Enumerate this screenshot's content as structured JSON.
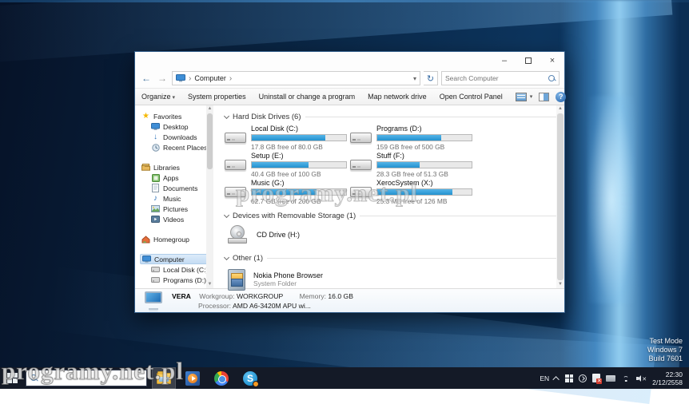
{
  "desktop": {
    "watermark_text": "programy.net.pl",
    "test_mode": {
      "l1": "Test Mode",
      "l2": "Windows 7",
      "l3": "Build 7601"
    }
  },
  "icons": {
    "back": "←",
    "forward": "→",
    "refresh": "↻",
    "caret": "▾",
    "breadcrumb_sep": "›",
    "minimize": "–",
    "close": "×",
    "help": "?",
    "star": "★",
    "music_note": "♪",
    "download_arrow": "↓",
    "scroll_up": "▲",
    "scroll_down": "▼",
    "skype_s": "S",
    "volume_mute": "✕"
  },
  "window": {
    "address": {
      "path": "Computer",
      "search_placeholder": "Search Computer"
    },
    "toolbar": {
      "organize": "Organize",
      "system_properties": "System properties",
      "uninstall": "Uninstall or change a program",
      "map_drive": "Map network drive",
      "control_panel": "Open Control Panel"
    },
    "sidebar": {
      "favorites": {
        "label": "Favorites",
        "items": [
          {
            "label": "Desktop"
          },
          {
            "label": "Downloads"
          },
          {
            "label": "Recent Places"
          }
        ]
      },
      "libraries": {
        "label": "Libraries",
        "items": [
          {
            "label": "Apps"
          },
          {
            "label": "Documents"
          },
          {
            "label": "Music"
          },
          {
            "label": "Pictures"
          },
          {
            "label": "Videos"
          }
        ]
      },
      "homegroup": {
        "label": "Homegroup"
      },
      "computer": {
        "label": "Computer",
        "items": [
          {
            "label": "Local Disk (C:)"
          },
          {
            "label": "Programs (D:)"
          }
        ]
      }
    },
    "groups": {
      "hdd_title": "Hard Disk Drives (6)",
      "removable_title": "Devices with Removable Storage (1)",
      "other_title": "Other (1)"
    },
    "drives": [
      {
        "name": "Local Disk (C:)",
        "free": "17.8 GB free of 80.0 GB",
        "used_percent": 78
      },
      {
        "name": "Programs (D:)",
        "free": "159 GB free of 500 GB",
        "used_percent": 68
      },
      {
        "name": "Setup (E:)",
        "free": "40.4 GB free of 100 GB",
        "used_percent": 60
      },
      {
        "name": "Stuff (F:)",
        "free": "28.3 GB free of 51.3 GB",
        "used_percent": 45
      },
      {
        "name": "Music (G:)",
        "free": "62.7 GB free of 200 GB",
        "used_percent": 69
      },
      {
        "name": "XerocSystem (X:)",
        "free": "25.3 MB free of 126 MB",
        "used_percent": 80
      }
    ],
    "removable_items": [
      {
        "name": "CD Drive (H:)"
      }
    ],
    "other_items": [
      {
        "name": "Nokia Phone Browser",
        "sub": "System Folder"
      }
    ],
    "details": {
      "computer_name": "VERA",
      "workgroup_label": "Workgroup:",
      "workgroup_value": "WORKGROUP",
      "memory_label": "Memory:",
      "memory_value": "16.0 GB",
      "processor_label": "Processor:",
      "processor_value": "AMD A6-3420M APU wi..."
    }
  },
  "taskbar": {
    "tray": {
      "language": "EN",
      "time": "22:30",
      "date": "2/12/2558"
    }
  }
}
